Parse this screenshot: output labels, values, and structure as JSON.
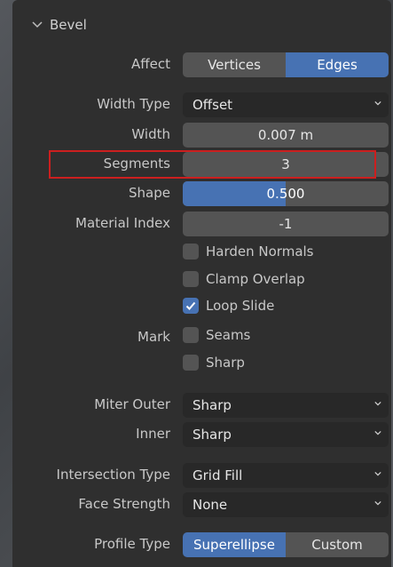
{
  "panel": {
    "title": "Bevel"
  },
  "affect": {
    "label": "Affect",
    "options": [
      "Vertices",
      "Edges"
    ],
    "selected": "Edges"
  },
  "width_type": {
    "label": "Width Type",
    "value": "Offset"
  },
  "width": {
    "label": "Width",
    "value": "0.007 m"
  },
  "segments": {
    "label": "Segments",
    "value": "3"
  },
  "shape": {
    "label": "Shape",
    "value": "0.500",
    "fraction": 0.5
  },
  "material_index": {
    "label": "Material Index",
    "value": "-1"
  },
  "checkboxes": {
    "harden_normals": {
      "label": "Harden Normals",
      "checked": false
    },
    "clamp_overlap": {
      "label": "Clamp Overlap",
      "checked": false
    },
    "loop_slide": {
      "label": "Loop Slide",
      "checked": true
    }
  },
  "mark": {
    "label": "Mark",
    "seams": {
      "label": "Seams",
      "checked": false
    },
    "sharp": {
      "label": "Sharp",
      "checked": false
    }
  },
  "miter_outer": {
    "label": "Miter Outer",
    "value": "Sharp"
  },
  "inner": {
    "label": "Inner",
    "value": "Sharp"
  },
  "intersection_type": {
    "label": "Intersection Type",
    "value": "Grid Fill"
  },
  "face_strength": {
    "label": "Face Strength",
    "value": "None"
  },
  "profile_type": {
    "label": "Profile Type",
    "options": [
      "Superellipse",
      "Custom"
    ],
    "selected": "Superellipse"
  },
  "colors": {
    "accent": "#4772b3",
    "panel_bg": "#2f2f2f",
    "field_bg": "#545454",
    "dropdown_bg": "#282828",
    "highlight": "#cc1f1f"
  }
}
